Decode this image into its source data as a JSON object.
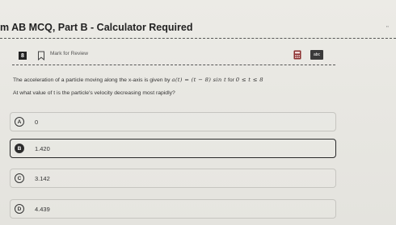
{
  "header": {
    "title": "m AB MCQ, Part B - Calculator Required",
    "corner_mark": "\""
  },
  "question": {
    "number": "8",
    "mark_for_review": "Mark for Review",
    "stem_line1_prefix": "The acceleration of a particle moving along the x-axis is given by",
    "stem_formula": "a(t) = (t − 8) sin t",
    "stem_for": "for",
    "stem_domain": "0 ≤ t ≤ 8",
    "stem_line2": "At what value of t is the particle's velocity decreasing most rapidly?"
  },
  "toolbar": {
    "calculator_icon": "calculator-icon",
    "reference_label": "abc"
  },
  "options": [
    {
      "letter": "A",
      "text": "0",
      "selected": false
    },
    {
      "letter": "B",
      "text": "1.420",
      "selected": true
    },
    {
      "letter": "C",
      "text": "3.142",
      "selected": false
    },
    {
      "letter": "D",
      "text": "4.439",
      "selected": false
    }
  ],
  "colors": {
    "background": "#e8e7e2",
    "selected_border": "#2a2a2a",
    "option_border": "#c6c5c0"
  }
}
